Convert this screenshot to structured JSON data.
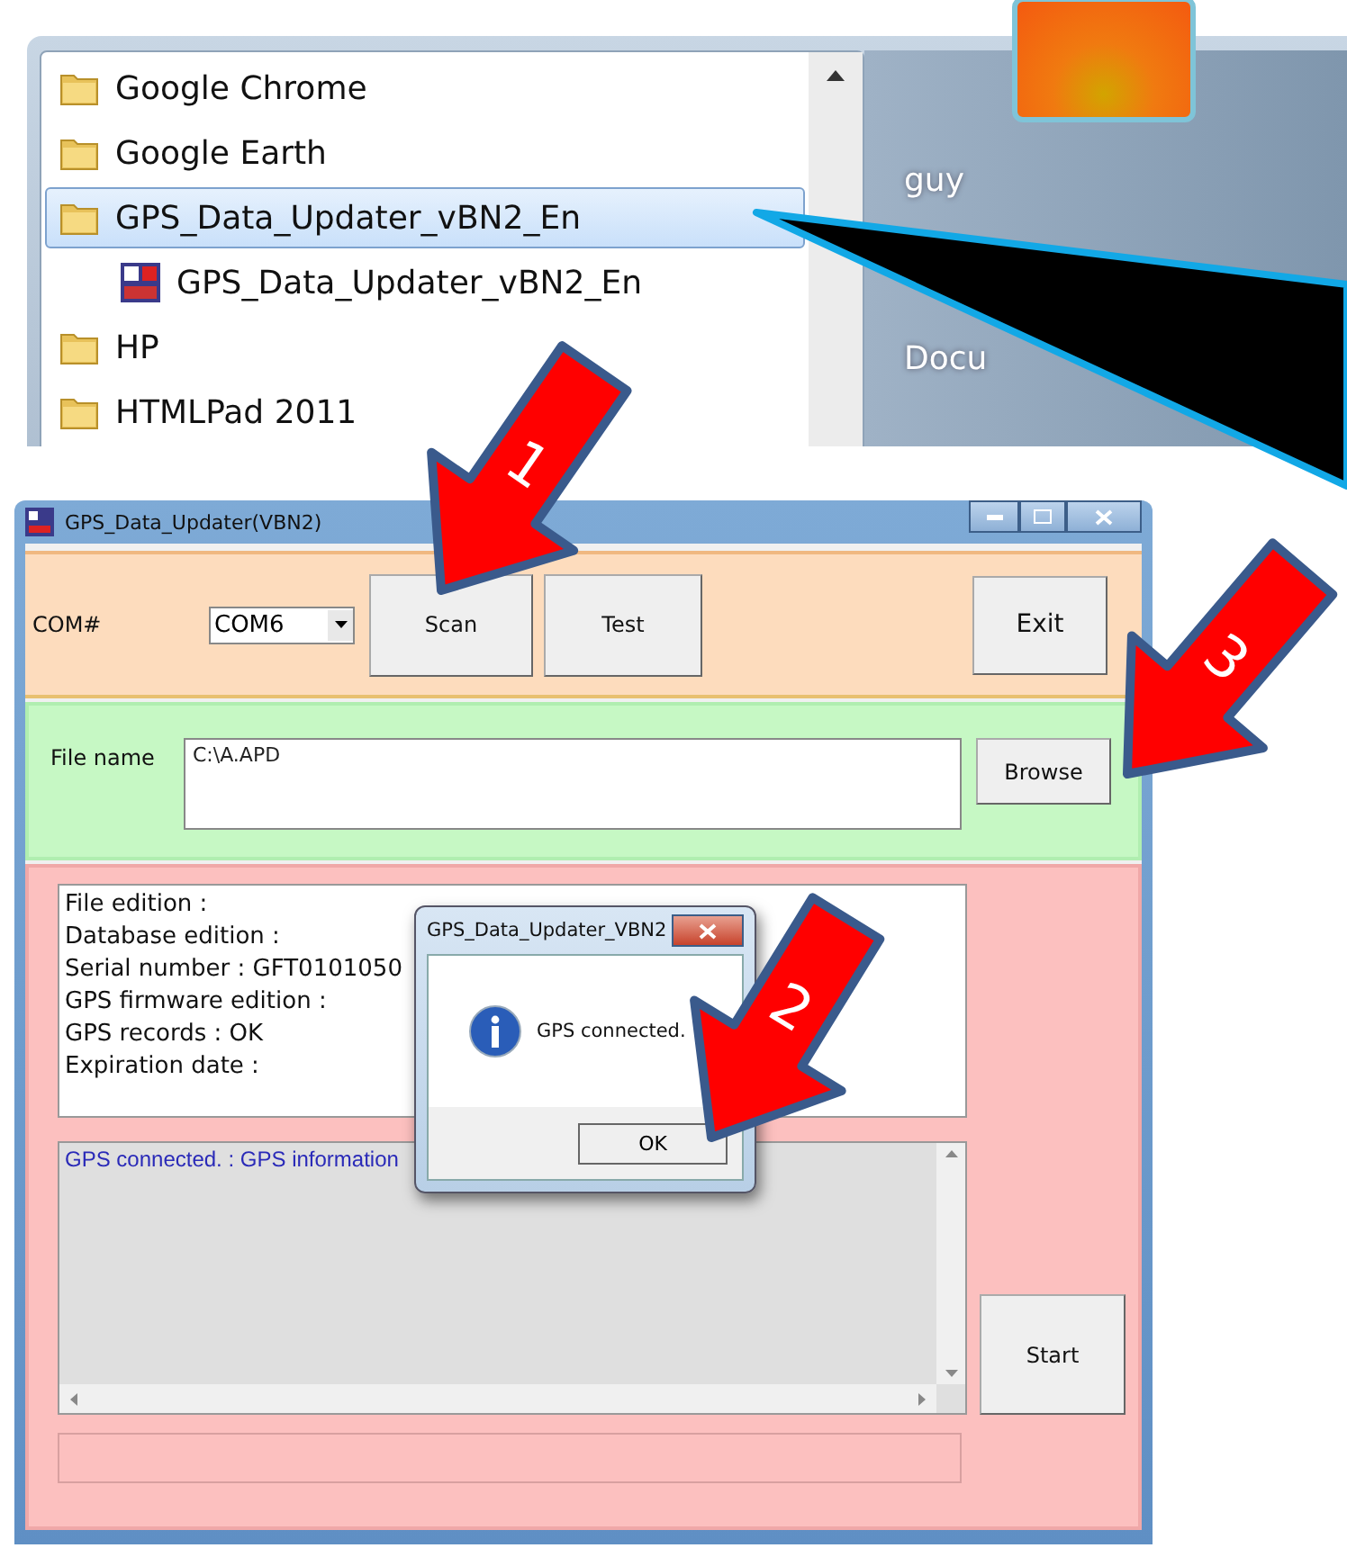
{
  "start_menu": {
    "items": [
      {
        "label": "Google Chrome",
        "kind": "folder",
        "selected": false
      },
      {
        "label": "Google Earth",
        "kind": "folder",
        "selected": false
      },
      {
        "label": "GPS_Data_Updater_vBN2_En",
        "kind": "folder",
        "selected": true
      },
      {
        "label": "GPS_Data_Updater_vBN2_En",
        "kind": "program",
        "selected": false
      },
      {
        "label": "HP",
        "kind": "folder",
        "selected": false
      },
      {
        "label": "HTMLPad 2011",
        "kind": "folder",
        "selected": false
      }
    ],
    "right_links": [
      "guy",
      "Docu"
    ]
  },
  "app_window": {
    "title": "GPS_Data_Updater(VBN2)",
    "com_label": "COM#",
    "com_port": "COM6",
    "top_buttons": [
      "Scan",
      "Test"
    ],
    "exit": "Exit",
    "file_label": "File name",
    "file_value": "C:\\A.APD",
    "browse": "Browse",
    "info_lines": [
      "File edition :",
      "Database edition :",
      "Serial number : GFT0101050",
      "GPS firmware edition :",
      "GPS records : OK",
      "Expiration date :"
    ],
    "log_text": "GPS connected. : GPS information",
    "start": "Start",
    "progress": {
      "level": 0
    }
  },
  "dialog": {
    "title": "GPS_Data_Updater_VBN2",
    "message": "GPS connected.",
    "ok": "OK"
  },
  "annotations": [
    {
      "number": "1"
    },
    {
      "number": "2"
    },
    {
      "number": "3"
    }
  ]
}
